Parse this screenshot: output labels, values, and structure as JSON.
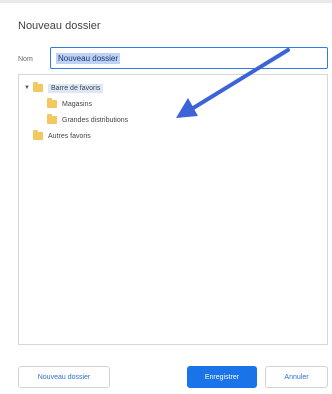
{
  "dialog": {
    "title": "Nouveau dossier",
    "name_label": "Nom",
    "name_value": "Nouveau dossier"
  },
  "tree": {
    "items": [
      {
        "label": "Barre de favoris",
        "icon": "folder-icon",
        "expanded": true,
        "selected": true
      },
      {
        "label": "Magasins",
        "icon": "folder-icon"
      },
      {
        "label": "Grandes distributions",
        "icon": "folder-icon"
      },
      {
        "label": "Autres favoris",
        "icon": "folder-icon"
      }
    ]
  },
  "buttons": {
    "new_folder": "Nouveau dossier",
    "save": "Enregistrer",
    "cancel": "Annuler"
  },
  "colors": {
    "accent": "#1a73e8",
    "arrow": "#3d63d8",
    "folder": "#f2c860"
  }
}
